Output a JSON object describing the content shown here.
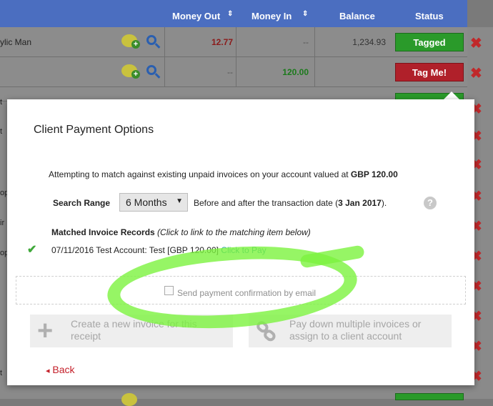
{
  "table": {
    "headers": {
      "money_out": "Money Out",
      "money_in": "Money In",
      "balance": "Balance",
      "status": "Status"
    },
    "sort_icon": "⇕",
    "rows": [
      {
        "name": "ylic Man",
        "money_out": "12.77",
        "money_in": "--",
        "balance": "1,234.93",
        "status": "Tagged"
      },
      {
        "name": "",
        "money_out": "--",
        "money_in": "120.00",
        "balance": "",
        "status": "Tag Me!"
      }
    ],
    "left_fragments": [
      "t",
      "t",
      "op",
      "ir",
      "op",
      "t"
    ],
    "delete_glyph": "✖"
  },
  "modal": {
    "title": "Client Payment Options",
    "attempt_text": "Attempting to match against existing unpaid invoices on your account valued at ",
    "attempt_amount": "GBP 120.00",
    "search_range_label": "Search Range",
    "search_range_value": "6 Months",
    "select_arrow": "▼",
    "before_after_text": "Before and after the transaction date (",
    "transaction_date": "3 Jan 2017",
    "before_after_tail": ").",
    "help_glyph": "?",
    "matched_label": "Matched Invoice Records",
    "matched_hint": " (Click to link to the matching item below)",
    "check_glyph": "✔",
    "invoice_line": "07/11/2016 Test Account: Test [GBP 120.00] ",
    "click_to_pay": "Click to Pay",
    "email_label": "Send payment confirmation by email",
    "create_invoice": "Create a new invoice for this receipt",
    "pay_down": "Pay down multiple invoices or assign to a client account",
    "plus_glyph": "+",
    "back_arrow": "◂",
    "back_label": "Back"
  },
  "colors": {
    "header_blue": "#4b6ec0",
    "tagged_green": "#2a9a2a",
    "tag_me_red": "#b0202a",
    "link_teal": "#2aa0a8",
    "highlight_green": "#7cf23f"
  }
}
